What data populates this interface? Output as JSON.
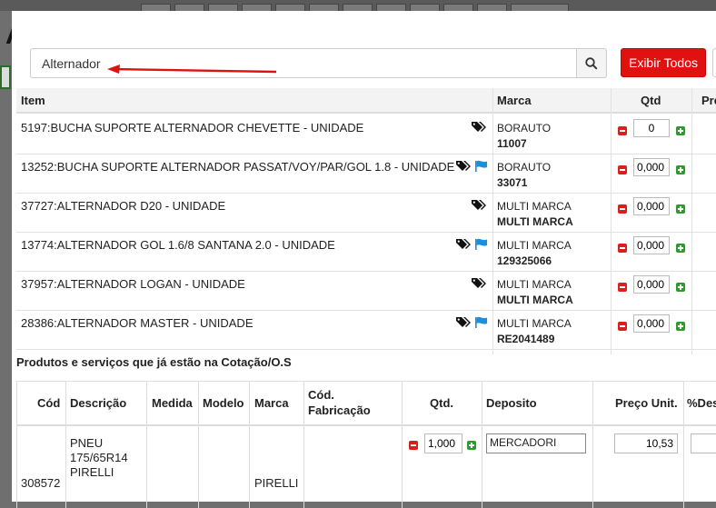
{
  "background": {
    "letter": "A"
  },
  "search": {
    "value": "Alternador",
    "button_icon": "search-icon"
  },
  "buttons": {
    "show_all": "Exibir Todos"
  },
  "results": {
    "headers": {
      "item": "Item",
      "marca": "Marca",
      "qtd": "Qtd",
      "preco": "Pre"
    },
    "rows": [
      {
        "item": "5197:BUCHA SUPORTE ALTERNADOR CHEVETTE - UNIDADE",
        "marca": "BORAUTO",
        "ref": "11007",
        "qty": "0"
      },
      {
        "item": "13252:BUCHA SUPORTE ALTERNADOR PASSAT/VOY/PAR/GOL 1.8 - UNIDADE",
        "marca": "BORAUTO",
        "ref": "33071",
        "qty": "0,000"
      },
      {
        "item": "37727:ALTERNADOR D20 - UNIDADE",
        "marca": "MULTI MARCA",
        "ref": "MULTI MARCA",
        "qty": "0,000"
      },
      {
        "item": "13774:ALTERNADOR GOL 1.6/8 SANTANA 2.0 - UNIDADE",
        "marca": "MULTI MARCA",
        "ref": "129325066",
        "qty": "0,000"
      },
      {
        "item": "37957:ALTERNADOR LOGAN - UNIDADE",
        "marca": "MULTI MARCA",
        "ref": "MULTI MARCA",
        "qty": "0,000"
      },
      {
        "item": "28386:ALTERNADOR MASTER - UNIDADE",
        "marca": "MULTI MARCA",
        "ref": "RE2041489",
        "qty": "0,000"
      }
    ]
  },
  "quote_section": {
    "title": "Produtos e serviços que já estão na Cotação/O.S",
    "headers": {
      "cod": "Cód",
      "descricao": "Descrição",
      "medida": "Medida",
      "modelo": "Modelo",
      "marca": "Marca",
      "cod_fab_1": "Cód.",
      "cod_fab_2": "Fabricação",
      "qtd": "Qtd.",
      "deposito": "Deposito",
      "preco_unit": "Preço Unit.",
      "desc": "%Des"
    },
    "row": {
      "cod": "308572",
      "descricao_1": "PNEU",
      "descricao_2": "175/65R14",
      "descricao_3": "PIRELLI",
      "marca": "PIRELLI",
      "qty": "1,000",
      "deposito": "MERCADORI",
      "preco": "10,53"
    }
  },
  "colors": {
    "danger": "#e0120f",
    "tag_blue": "#1a8fe0",
    "plus_green": "#2e9a2e"
  }
}
